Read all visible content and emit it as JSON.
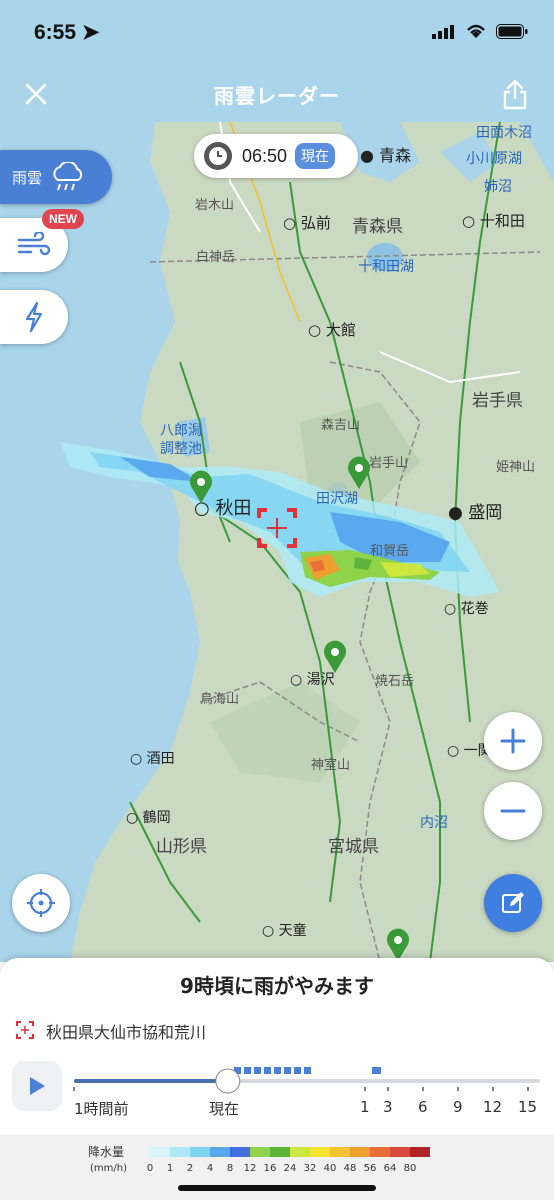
{
  "status_bar": {
    "time": "6:55"
  },
  "header": {
    "title": "雨雲レーダー"
  },
  "time_chip": {
    "time": "06:50",
    "badge": "現在"
  },
  "layers": {
    "rain_label": "雨雲",
    "new_badge": "NEW"
  },
  "map_labels": {
    "aomori": "青森",
    "aomori_pref": "青森県",
    "hirosaki": "弘前",
    "towada": "十和田",
    "lake_towada": "十和田湖",
    "iwakiyama": "岩木山",
    "shirakami": "白神岳",
    "odate": "大館",
    "iwate_pref": "岩手県",
    "moriyoshi": "森吉山",
    "hachirogata": "八郎潟\n調整池",
    "iwatesan": "岩手山",
    "himekami": "姫神山",
    "tazawako": "田沢湖",
    "akita": "秋田",
    "morioka": "盛岡",
    "waga": "和賀岳",
    "hanamaki": "花巻",
    "yuzawa": "湯沢",
    "chokai": "鳥海山",
    "yakeishi": "焼石岳",
    "sakata": "酒田",
    "ichinoseki": "一関",
    "kamuro": "神室山",
    "tsuruoka": "鶴岡",
    "yamagata_pref": "山形県",
    "miyagi_pref": "宮城県",
    "uchinuma": "内沼",
    "tendo": "天童",
    "tanabu": "田面木沼",
    "ogawara": "小川原湖",
    "anenuma": "姉沼"
  },
  "forecast": {
    "message": "9時頃に雨がやみます",
    "location": "秋田県大仙市協和荒川"
  },
  "timeline": {
    "labels": [
      "1時間前",
      "現在",
      "1",
      "3",
      "6",
      "9",
      "12",
      "15"
    ],
    "position_fraction": 0.33
  },
  "legend": {
    "title": "降水量",
    "unit": "(mm/h)",
    "ticks": [
      "0",
      "1",
      "2",
      "4",
      "8",
      "12",
      "16",
      "24",
      "32",
      "40",
      "48",
      "56",
      "64",
      "80"
    ],
    "colors": [
      "#d8f6fb",
      "#aeeaf6",
      "#7fd4f2",
      "#5aa9ef",
      "#3f6fe0",
      "#8fd34a",
      "#5fb33b",
      "#cce63d",
      "#f5e52f",
      "#f3c233",
      "#ef9f2f",
      "#e8703a",
      "#d9493d",
      "#b02424"
    ]
  },
  "colors": {
    "header": "#a9d4ea",
    "accent": "#4a7fd6",
    "badge": "#e0454f",
    "sea": "#a9d4ea",
    "land": "#c9d9c2"
  }
}
